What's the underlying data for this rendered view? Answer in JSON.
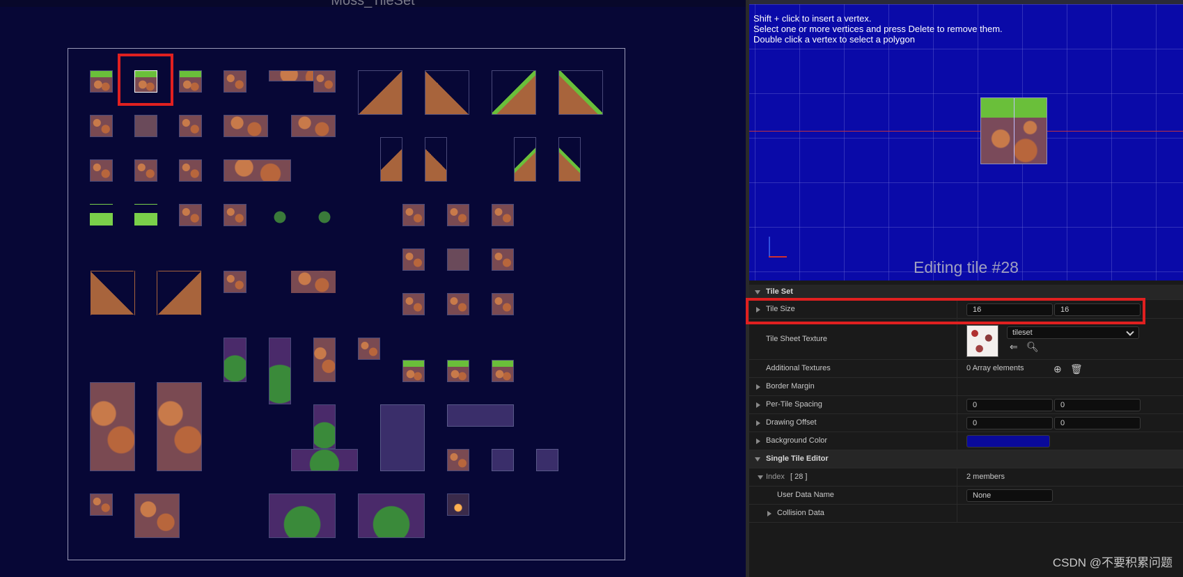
{
  "left_panel": {
    "title": "Moss_TileSet"
  },
  "viewport": {
    "hints": [
      "Shift + click to insert a vertex.",
      "Select one or more vertices and press Delete to remove them.",
      "Double click a vertex to select a polygon"
    ],
    "editing_label": "Editing tile #28"
  },
  "details": {
    "tile_set_header": "Tile Set",
    "tile_size": {
      "label": "Tile Size",
      "x": "16",
      "y": "16"
    },
    "tile_sheet_texture": {
      "label": "Tile Sheet Texture",
      "value": "tileset"
    },
    "additional_textures": {
      "label": "Additional Textures",
      "value": "0 Array elements"
    },
    "border_margin": {
      "label": "Border Margin"
    },
    "per_tile_spacing": {
      "label": "Per-Tile Spacing",
      "x": "0",
      "y": "0"
    },
    "drawing_offset": {
      "label": "Drawing Offset",
      "x": "0",
      "y": "0"
    },
    "background_color": {
      "label": "Background Color",
      "color": "#0a0a9a"
    },
    "single_tile_editor_header": "Single Tile Editor",
    "index": {
      "label": "Index",
      "number": "[ 28 ]",
      "value": "2 members"
    },
    "user_data_name": {
      "label": "User Data Name",
      "value": "None"
    },
    "collision_data": {
      "label": "Collision Data"
    }
  },
  "watermark": "CSDN @不要积累问题",
  "colors": {
    "selection_highlight": "#e02020",
    "viewport_bg": "#0a0aa8",
    "sheet_bg": "#070736"
  }
}
